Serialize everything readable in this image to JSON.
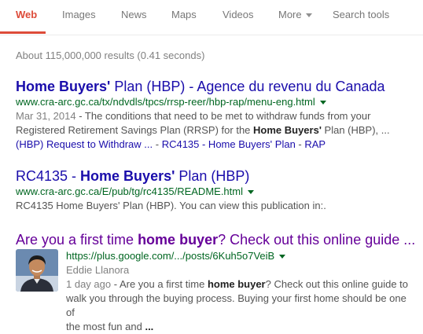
{
  "tabs": {
    "web": "Web",
    "images": "Images",
    "news": "News",
    "maps": "Maps",
    "videos": "Videos",
    "more": "More",
    "search_tools": "Search tools"
  },
  "stats": "About 115,000,000 results (0.41 seconds)",
  "results": [
    {
      "title_bold": "Home Buyers'",
      "title_rest": " Plan (HBP) - Agence du revenu du Canada",
      "url": "www.cra-arc.gc.ca/tx/ndvdls/tpcs/rrsp-reer/hbp-rap/menu-eng.html",
      "date": "Mar 31, 2014",
      "snippet_a": " - The conditions that need to be met to withdraw funds from your",
      "snippet_b": "Registered Retirement Savings Plan (RRSP) for the ",
      "snippet_b_bold": "Home Buyers'",
      "snippet_b_rest": " Plan (HBP), ...",
      "sitelinks": [
        "(HBP) Request to Withdraw ...",
        "RC4135 - Home Buyers' Plan",
        "RAP"
      ],
      "sitelink_sep": " - "
    },
    {
      "title_pre": "RC4135 - ",
      "title_bold": "Home Buyers'",
      "title_rest": " Plan (HBP)",
      "url": "www.cra-arc.gc.ca/E/pub/tg/rc4135/README.html",
      "snippet": "RC4135 Home Buyers' Plan (HBP). You can view this publication in:."
    },
    {
      "title_pre": "Are you a first time ",
      "title_bold": "home buyer",
      "title_rest": "? Check out this online guide ...",
      "url": "https://plus.google.com/.../posts/6Kuh5o7VeiB",
      "author": "Eddie Llanora",
      "date": "1 day ago",
      "snippet_a": " - Are you a first time ",
      "snippet_a_bold": "home buyer",
      "snippet_a_rest": "? Check out this online guide to",
      "snippet_b": "walk you through the buying process. Buying your first home should be one of",
      "snippet_c": "the most fun and ",
      "snippet_c_bold": "...",
      "avatar_icon": "person-avatar"
    }
  ],
  "colors": {
    "accent": "#dd4b39",
    "link": "#1a0dab",
    "visited": "#660099",
    "url": "#006621",
    "snippet": "#545454"
  }
}
